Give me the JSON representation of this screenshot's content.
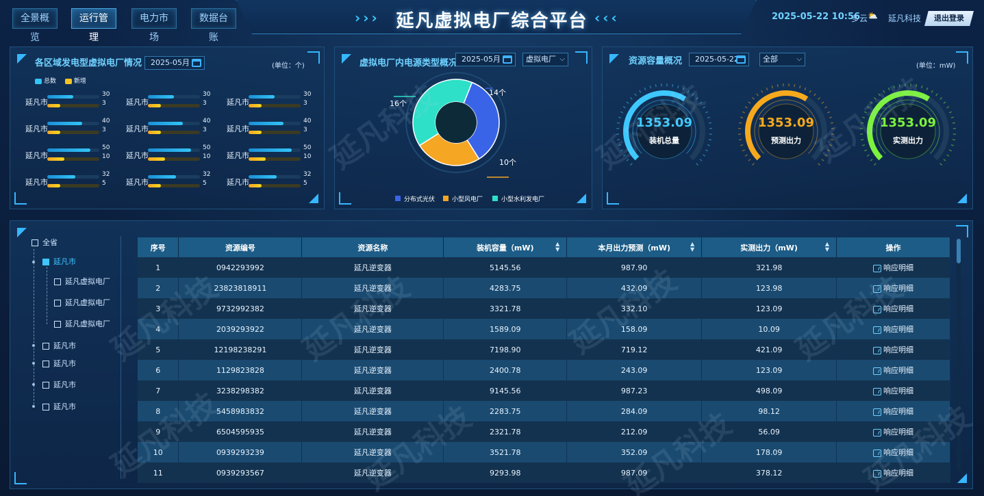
{
  "nav": [
    {
      "label": "全景概览",
      "active": false
    },
    {
      "label": "运行管理",
      "active": true
    },
    {
      "label": "电力市场",
      "active": false
    },
    {
      "label": "数据台账",
      "active": false
    }
  ],
  "header": {
    "title": "延凡虚拟电厂综合平台",
    "datetime": "2025-05-22 10:56",
    "weather": "多云",
    "company": "延凡科技",
    "logout_label": "退出登录"
  },
  "region_panel": {
    "title": "各区域发电型虚拟电厂情况",
    "date": "2025-05月",
    "unit": "(单位：个)",
    "legend": [
      {
        "label": "总数",
        "color": "#33c4f5"
      },
      {
        "label": "新增",
        "color": "#f5c422"
      }
    ],
    "max": 60,
    "rows": [
      [
        {
          "city": "延凡市",
          "total": 30,
          "new": 3
        },
        {
          "city": "延凡市",
          "total": 30,
          "new": 3
        },
        {
          "city": "延凡市",
          "total": 30,
          "new": 3
        }
      ],
      [
        {
          "city": "延凡市",
          "total": 40,
          "new": 3
        },
        {
          "city": "延凡市",
          "total": 40,
          "new": 3
        },
        {
          "city": "延凡市",
          "total": 40,
          "new": 3
        }
      ],
      [
        {
          "city": "延凡市",
          "total": 50,
          "new": 10
        },
        {
          "city": "延凡市",
          "total": 50,
          "new": 10
        },
        {
          "city": "延凡市",
          "total": 50,
          "new": 10
        }
      ],
      [
        {
          "city": "延凡市",
          "total": 32,
          "new": 5
        },
        {
          "city": "延凡市",
          "total": 32,
          "new": 5
        },
        {
          "city": "延凡市",
          "total": 32,
          "new": 5
        }
      ]
    ]
  },
  "source_panel": {
    "title": "虚拟电厂内电源类型概况",
    "date": "2025-05月",
    "select": "虚拟电厂"
  },
  "chart_data": {
    "type": "pie",
    "categories": [
      "分布式光伏",
      "小型风电厂",
      "小型水利发电厂"
    ],
    "values": [
      14,
      10,
      16
    ],
    "value_labels": [
      "14个",
      "10个",
      "16个"
    ],
    "colors": [
      "#3a64e8",
      "#f5a623",
      "#2de0c7"
    ]
  },
  "capacity_panel": {
    "title": "资源容量概况",
    "date": "2025-05-22",
    "select": "全部",
    "unit": "(单位：mW)",
    "gauges": [
      {
        "value": "1353.09",
        "label": "装机总量",
        "color": "#3ec8ff",
        "level": 0.62
      },
      {
        "value": "1353.09",
        "label": "预测出力",
        "color": "#f7a91d",
        "level": 0.62
      },
      {
        "value": "1353.09",
        "label": "实测出力",
        "color": "#7cf23c",
        "level": 0.62
      }
    ]
  },
  "tree": {
    "root": "全省",
    "selected": "延凡市",
    "children": [
      "延凡虚拟电厂",
      "延凡虚拟电厂",
      "延凡虚拟电厂"
    ],
    "others": [
      "延凡市",
      "延凡市",
      "延凡市",
      "延凡市"
    ]
  },
  "table": {
    "headers": [
      "序号",
      "资源编号",
      "资源名称",
      "装机容量（mW)",
      "本月出力预测（mW)",
      "实测出力（mW)",
      "操作"
    ],
    "action_label": "响应明细",
    "rows": [
      [
        "1",
        "0942293992",
        "延凡逆变器",
        "5145.56",
        "987.90",
        "321.98"
      ],
      [
        "2",
        "23823818911",
        "延凡逆变器",
        "4283.75",
        "432.09",
        "123.98"
      ],
      [
        "3",
        "9732992382",
        "延凡逆变器",
        "3321.78",
        "332.10",
        "123.09"
      ],
      [
        "4",
        "2039293922",
        "延凡逆变器",
        "1589.09",
        "158.09",
        "10.09"
      ],
      [
        "5",
        "12198238291",
        "延凡逆变器",
        "7198.90",
        "719.12",
        "421.09"
      ],
      [
        "6",
        "1129823828",
        "延凡逆变器",
        "2400.78",
        "243.09",
        "123.09"
      ],
      [
        "7",
        "3238298382",
        "延凡逆变器",
        "9145.56",
        "987.23",
        "498.09"
      ],
      [
        "8",
        "5458983832",
        "延凡逆变器",
        "2283.75",
        "284.09",
        "98.12"
      ],
      [
        "9",
        "6504595935",
        "延凡逆变器",
        "2321.78",
        "212.09",
        "56.09"
      ],
      [
        "10",
        "0939293239",
        "延凡逆变器",
        "3521.78",
        "352.09",
        "178.09"
      ],
      [
        "11",
        "0939293567",
        "延凡逆变器",
        "9293.98",
        "987.09",
        "378.12"
      ]
    ]
  },
  "watermark": "延凡科技"
}
